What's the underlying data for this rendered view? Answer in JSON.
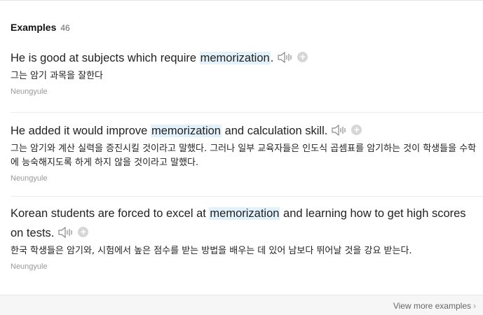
{
  "header": {
    "title": "Examples",
    "count": "46"
  },
  "examples": [
    {
      "en_before": "He is good at subjects which require ",
      "en_highlight": "memorization",
      "en_after": ".",
      "ko": "그는 암기 과목을 잘한다",
      "source": "Neungyule"
    },
    {
      "en_before": "He added it would improve ",
      "en_highlight": "memorization",
      "en_after": " and calculation skill.",
      "ko": "그는 암기와 계산 실력을 증진시킬 것이라고 말했다. 그러나 일부 교육자들은 인도식 곱셈표를 암기하는 것이 학생들을 수학에 능숙해지도록 하게 하지 않을 것이라고 말했다.",
      "source": "Neungyule"
    },
    {
      "en_before": "Korean students are forced to excel at ",
      "en_highlight": "memorization",
      "en_after": " and learning how to get high scores on tests.",
      "ko": "한국 학생들은 암기와, 시험에서 높은 점수를 받는 방법을 배우는 데 있어 남보다 뛰어날 것을 강요 받는다.",
      "source": "Neungyule"
    }
  ],
  "footer": {
    "view_more": "View more examples"
  },
  "icons": {
    "speaker": "speaker-icon",
    "add": "plus-circle-icon",
    "chevron": "chevron-right-icon"
  }
}
